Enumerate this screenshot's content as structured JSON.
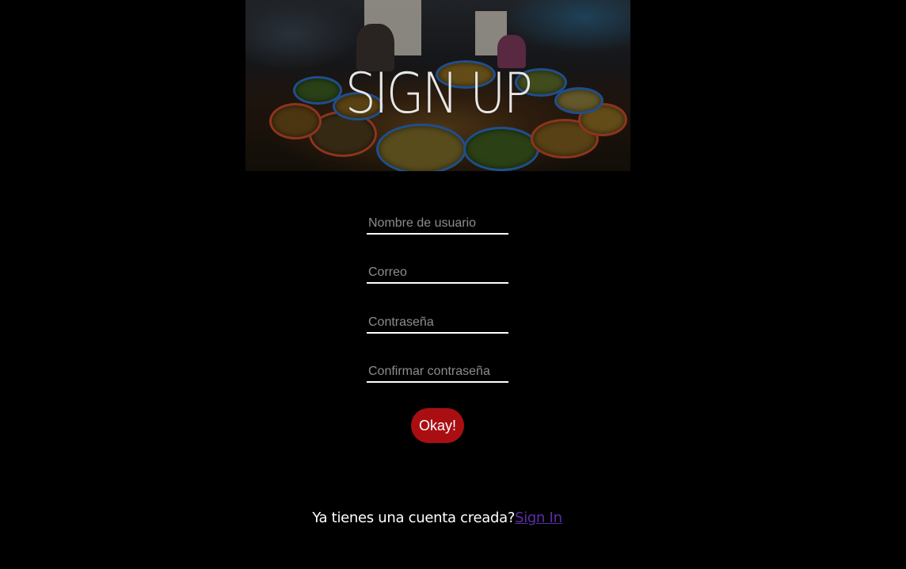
{
  "hero": {
    "title": "SIGN UP"
  },
  "form": {
    "username": {
      "placeholder": "Nombre de usuario",
      "value": ""
    },
    "email": {
      "placeholder": "Correo",
      "value": ""
    },
    "password": {
      "placeholder": "Contraseña",
      "value": ""
    },
    "confirm_password": {
      "placeholder": "Confirmar contraseña",
      "value": ""
    },
    "submit_label": "Okay!"
  },
  "footer": {
    "prompt": "Ya tienes una cuenta creada?",
    "link_label": "Sign In"
  },
  "colors": {
    "background": "#000000",
    "button": "#a90f12",
    "link": "#5b2ea8",
    "field_underline": "#ffffff"
  }
}
